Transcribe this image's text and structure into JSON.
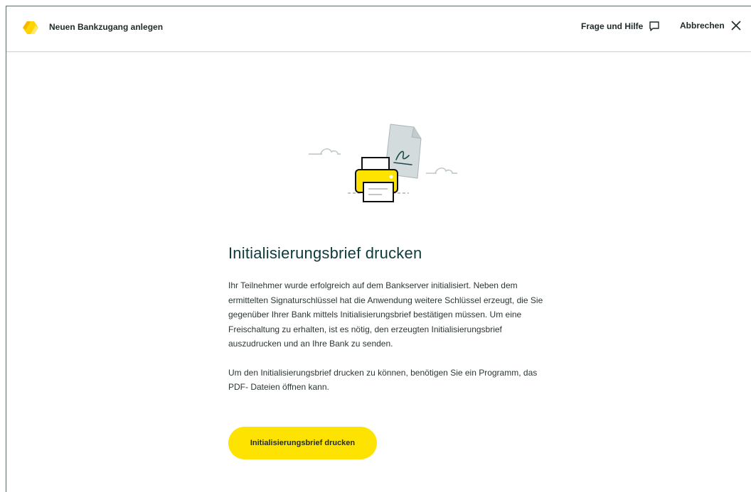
{
  "header": {
    "title": "Neuen Bankzugang anlegen",
    "help_label": "Frage und Hilfe",
    "cancel_label": "Abbrechen"
  },
  "main": {
    "heading": "Initialisierungsbrief drucken",
    "paragraphs": [
      "Ihr Teilnehmer wurde erfolgreich auf dem Bankserver initialisiert. Neben dem ermittelten Signaturschlüssel hat die Anwendung weitere Schlüssel erzeugt, die Sie gegenüber Ihrer Bank mittels Initialisierungsbrief bestätigen müssen. Um eine Freischaltung zu erhalten, ist es nötig, den erzeugten Initialisierungsbrief auszudrucken und an Ihre Bank zu senden.",
      "Um den Initialisierungsbrief drucken zu können, benötigen Sie ein Programm, das PDF- Dateien öffnen kann."
    ],
    "button_label": "Initialisierungsbrief drucken"
  },
  "icons": {
    "logo": "commerzbank-logo-icon",
    "help": "speech-bubble-icon",
    "cancel": "close-icon",
    "illustration": "printer-with-signed-document-illustration"
  },
  "colors": {
    "accent": "#ffe300",
    "heading": "#0f3a3c",
    "text": "#2c3636"
  }
}
